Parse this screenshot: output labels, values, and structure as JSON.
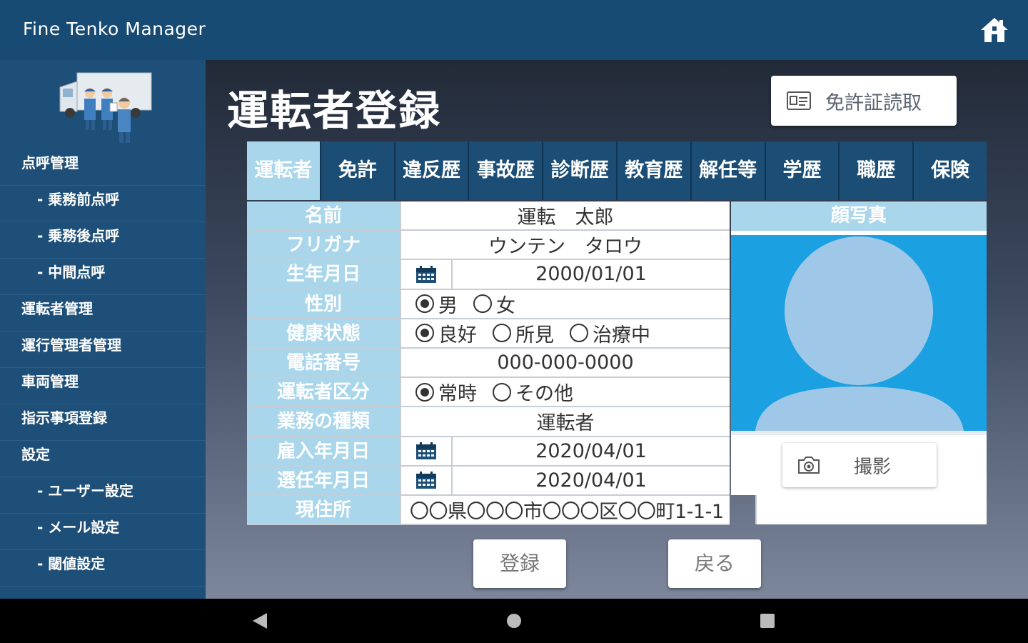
{
  "app": {
    "title": "Fine Tenko Manager"
  },
  "sidebar": {
    "items": [
      {
        "label": "点呼管理"
      },
      {
        "label": "- 乗務前点呼"
      },
      {
        "label": "- 乗務後点呼"
      },
      {
        "label": "- 中間点呼"
      },
      {
        "label": "運転者管理"
      },
      {
        "label": "運行管理者管理"
      },
      {
        "label": "車両管理"
      },
      {
        "label": "指示事項登録"
      },
      {
        "label": "設定"
      },
      {
        "label": "- ユーザー設定"
      },
      {
        "label": "- メール設定"
      },
      {
        "label": "- 閾値設定"
      }
    ]
  },
  "main": {
    "title": "運転者登録",
    "license_button": "免許証読取",
    "tabs": [
      "運転者",
      "免許",
      "違反歴",
      "事故歴",
      "診断歴",
      "教育歴",
      "解任等",
      "学歴",
      "職歴",
      "保険"
    ],
    "active_tab": "運転者",
    "form": {
      "name": {
        "label": "名前",
        "value": "運転　太郎"
      },
      "furigana": {
        "label": "フリガナ",
        "value": "ウンテン　タロウ"
      },
      "birthdate": {
        "label": "生年月日",
        "value": "2000/01/01"
      },
      "gender": {
        "label": "性別",
        "options": [
          "男",
          "女"
        ],
        "selected": "男"
      },
      "health": {
        "label": "健康状態",
        "options": [
          "良好",
          "所見",
          "治療中"
        ],
        "selected": "良好"
      },
      "phone": {
        "label": "電話番号",
        "value": "000-000-0000"
      },
      "driver_class": {
        "label": "運転者区分",
        "options": [
          "常時",
          "その他"
        ],
        "selected": "常時"
      },
      "job_type": {
        "label": "業務の種類",
        "value": "運転者"
      },
      "hire_date": {
        "label": "雇入年月日",
        "value": "2020/04/01"
      },
      "appoint_date": {
        "label": "選任年月日",
        "value": "2020/04/01"
      },
      "address": {
        "label": "現住所",
        "value": "〇〇県〇〇〇市〇〇〇区〇〇町1-1-1"
      }
    },
    "photo": {
      "header": "顔写真",
      "shoot_button": "撮影"
    },
    "buttons": {
      "register": "登録",
      "back": "戻る"
    }
  },
  "colors": {
    "header": "#174b73",
    "sidebar": "#1d4f78",
    "tab": "#1b4d75",
    "label_bg": "#a9d6ea",
    "photo_bg": "#1ba0e2"
  },
  "icons": [
    "home-icon",
    "id-card-icon",
    "calendar-icon",
    "camera-icon",
    "back-triangle-icon",
    "home-circle-icon",
    "recents-square-icon"
  ]
}
